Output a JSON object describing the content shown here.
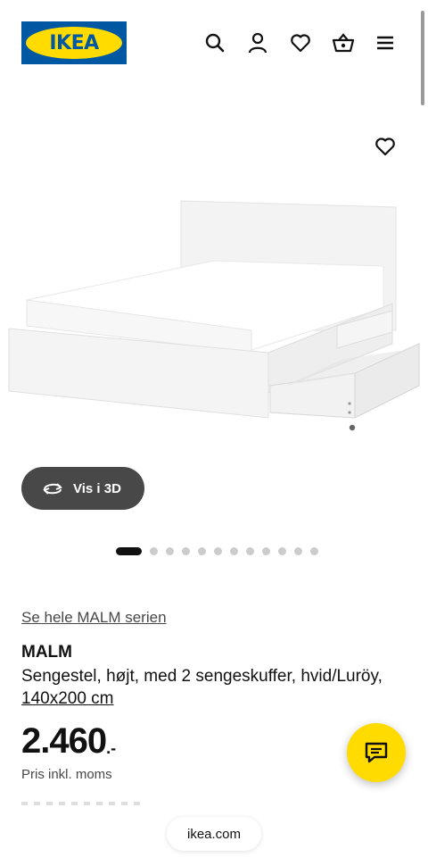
{
  "header": {
    "logo_text": "IKEA",
    "brand_colors": {
      "blue": "#0058a3",
      "yellow": "#ffdb00"
    },
    "icons": [
      "search-icon",
      "user-icon",
      "heart-icon",
      "basket-icon",
      "menu-icon"
    ]
  },
  "hero": {
    "favorite_icon": "heart-icon",
    "view_3d_label": "Vis i 3D",
    "view_3d_icon": "rotate-icon",
    "carousel": {
      "total": 12,
      "active_index": 0
    }
  },
  "product": {
    "series_link": "Se hele MALM serien",
    "name": "MALM",
    "description": "Sengestel, højt, med 2 sengeskuffer, hvid/Luröy,",
    "size": "140x200 cm",
    "price": "2.460",
    "price_suffix": ".-",
    "price_note": "Pris inkl. moms"
  },
  "chat": {
    "icon": "chat-icon"
  },
  "browser": {
    "url": "ikea.com"
  }
}
